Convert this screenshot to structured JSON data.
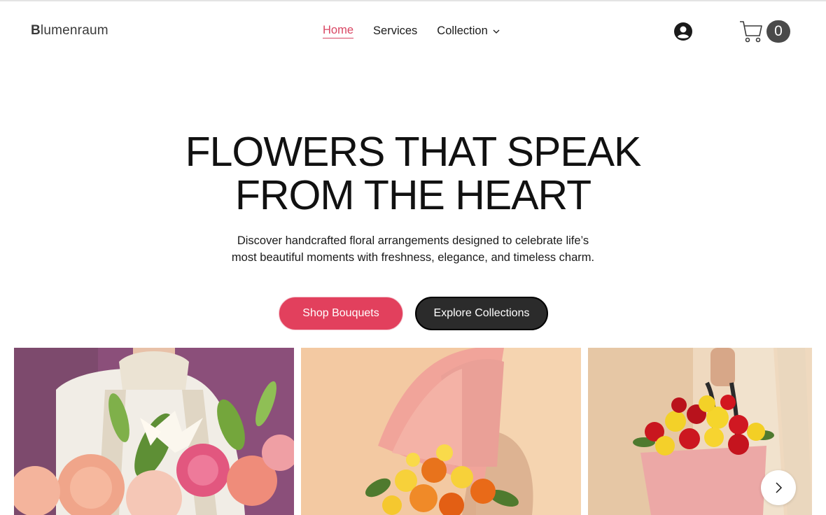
{
  "header": {
    "logo_initial": "B",
    "logo_rest": "lumenraum",
    "nav": [
      {
        "label": "Home",
        "active": true
      },
      {
        "label": "Services",
        "active": false
      },
      {
        "label": "Collection",
        "active": false,
        "has_dropdown": true
      }
    ],
    "account_icon": "user-circle-icon",
    "cart_icon": "shopping-cart-icon",
    "cart_count": "0"
  },
  "hero": {
    "title_line1": "FLOWERS THAT SPEAK",
    "title_line2": "FROM THE HEART",
    "subtitle": "Discover handcrafted floral arrangements designed to celebrate life’s most beautiful moments with freshness, elegance, and timeless charm.",
    "primary_cta": "Shop Bouquets",
    "secondary_cta": "Explore Collections"
  },
  "gallery": {
    "next_icon": "chevron-right-icon"
  },
  "colors": {
    "accent": "#e2405d",
    "active_nav": "#d94663",
    "dark_button": "#2b2b2b",
    "cart_badge": "#4a4a4a"
  }
}
